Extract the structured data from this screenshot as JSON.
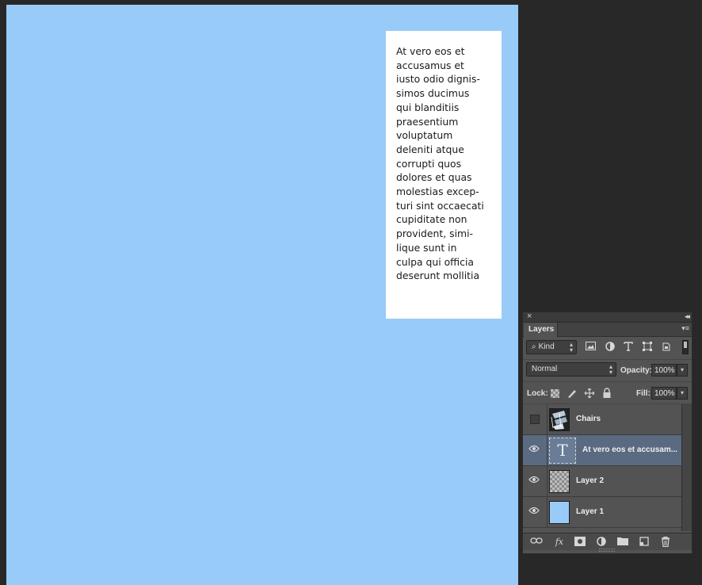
{
  "document": {
    "canvas_color": "#99cbf8",
    "text_layer_content": "At vero eos et\naccusamus et\niusto odio dignis-\nsimos ducimus\nqui blanditiis\npraesentium\nvoluptatum\ndeleniti atque\ncorrupti quos\ndolores et quas\nmolestias excep-\nturi sint occaecati\ncupiditate non\nprovident, simi-\nlique sunt in\nculpa qui officia\ndeserunt mollitia"
  },
  "layers_panel": {
    "close_glyph": "×",
    "collapse_glyph": "◂◂",
    "tab_label": "Layers",
    "menu_glyph": "▾≡",
    "filter": {
      "kind_label": "Kind",
      "search_glyph": "⌕",
      "icons": [
        "image-filter-icon",
        "adjustment-filter-icon",
        "type-filter-icon",
        "shape-filter-icon",
        "smart-object-filter-icon"
      ]
    },
    "blend_mode": "Normal",
    "opacity_label": "Opacity:",
    "opacity_value": "100%",
    "lock_label": "Lock:",
    "fill_label": "Fill:",
    "fill_value": "100%",
    "layers": [
      {
        "name": "Chairs",
        "visible": false,
        "selected": false,
        "kind": "image"
      },
      {
        "name": "At vero eos et accusam...",
        "visible": true,
        "selected": true,
        "kind": "text",
        "thumb_glyph": "T"
      },
      {
        "name": "Layer 2",
        "visible": true,
        "selected": false,
        "kind": "transparent"
      },
      {
        "name": "Layer 1",
        "visible": true,
        "selected": false,
        "kind": "fill",
        "thumb_color": "#99cbf8"
      }
    ],
    "bottom_glyphs": {
      "link": "⛓",
      "fx": "fx",
      "mask": "◙",
      "adjust": "◐",
      "group": "▬",
      "new": "❐",
      "trash": "🗑"
    },
    "eye_glyph": "👁"
  }
}
